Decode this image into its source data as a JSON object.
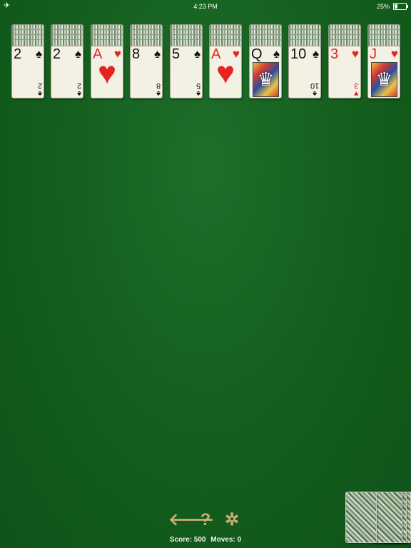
{
  "statusbar": {
    "time": "4:23 PM",
    "battery": "25%",
    "battery_level": 0.25,
    "airplane_icon": "airplane-icon"
  },
  "colors": {
    "felt": "#15601f",
    "red_suit": "#e52421",
    "black_suit": "#111111",
    "toolbar_icon": "#c9ad73"
  },
  "tableau": [
    {
      "hidden": 4,
      "rank": "2",
      "suit": "♠",
      "color": "black"
    },
    {
      "hidden": 4,
      "rank": "2",
      "suit": "♠",
      "color": "black"
    },
    {
      "hidden": 4,
      "rank": "A",
      "suit": "♥",
      "color": "red"
    },
    {
      "hidden": 4,
      "rank": "8",
      "suit": "♠",
      "color": "black"
    },
    {
      "hidden": 4,
      "rank": "5",
      "suit": "♠",
      "color": "black"
    },
    {
      "hidden": 4,
      "rank": "A",
      "suit": "♥",
      "color": "red"
    },
    {
      "hidden": 4,
      "rank": "Q",
      "suit": "♠",
      "color": "black"
    },
    {
      "hidden": 4,
      "rank": "10",
      "suit": "♠",
      "color": "black"
    },
    {
      "hidden": 4,
      "rank": "3",
      "suit": "♥",
      "color": "red"
    },
    {
      "hidden": 4,
      "rank": "J",
      "suit": "♥",
      "color": "red"
    }
  ],
  "stock": {
    "cards": 5,
    "icon": "card-back-icon"
  },
  "toolbar": {
    "undo": {
      "glyph": "🡐",
      "icon": "undo-arrow-icon"
    },
    "help": {
      "glyph": "?",
      "icon": "help-icon"
    },
    "settings": {
      "glyph": "✲",
      "icon": "flower-settings-icon"
    }
  },
  "score": {
    "score_label": "Score: 500",
    "moves_label": "Moves: 0"
  }
}
